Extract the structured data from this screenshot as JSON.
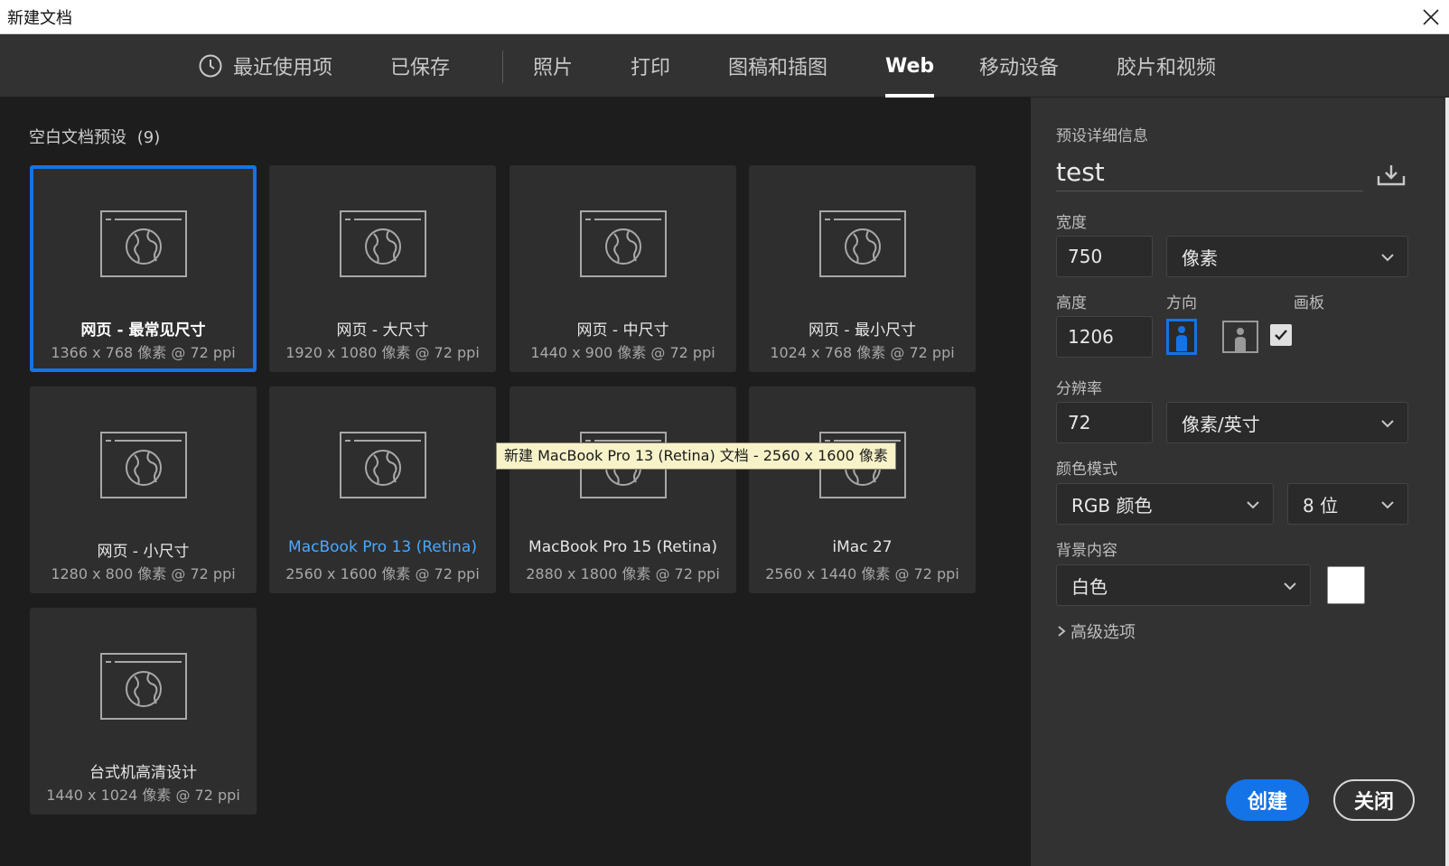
{
  "window": {
    "title": "新建文档",
    "close_icon": "close-icon"
  },
  "tabs": [
    {
      "label": "最近使用项",
      "icon": "clock-icon"
    },
    {
      "label": "已保存"
    },
    {
      "label": "照片"
    },
    {
      "label": "打印"
    },
    {
      "label": "图稿和插图"
    },
    {
      "label": "Web",
      "active": true
    },
    {
      "label": "移动设备"
    },
    {
      "label": "胶片和视频"
    }
  ],
  "presets": {
    "title": "空白文档预设",
    "count": "(9)",
    "items": [
      {
        "name": "网页 - 最常见尺寸",
        "dims": "1366 x 768 像素 @ 72 ppi",
        "selected": true
      },
      {
        "name": "网页 - 大尺寸",
        "dims": "1920 x 1080 像素 @ 72 ppi"
      },
      {
        "name": "网页 - 中尺寸",
        "dims": "1440 x 900 像素 @ 72 ppi"
      },
      {
        "name": "网页 - 最小尺寸",
        "dims": "1024 x 768 像素 @ 72 ppi"
      },
      {
        "name": "网页 - 小尺寸",
        "dims": "1280 x 800 像素 @ 72 ppi"
      },
      {
        "name": "MacBook Pro 13 (Retina)",
        "dims": "2560 x 1600 像素 @ 72 ppi",
        "hover": true
      },
      {
        "name": "MacBook Pro 15 (Retina)",
        "dims": "2880 x 1800 像素 @ 72 ppi"
      },
      {
        "name": "iMac 27",
        "dims": "2560 x 1440 像素 @ 72 ppi"
      },
      {
        "name": "台式机高清设计",
        "dims": "1440 x 1024 像素 @ 72 ppi"
      }
    ],
    "tooltip": "新建 MacBook Pro 13 (Retina) 文档 - 2560 x 1600 像素"
  },
  "details": {
    "header": "预设详细信息",
    "name": "test",
    "width_label": "宽度",
    "width_value": "750",
    "width_unit": "像素",
    "height_label": "高度",
    "height_value": "1206",
    "orientation_label": "方向",
    "artboard_label": "画板",
    "artboard_checked": true,
    "resolution_label": "分辨率",
    "resolution_value": "72",
    "resolution_unit": "像素/英寸",
    "color_mode_label": "颜色模式",
    "color_mode": "RGB 颜色",
    "bit_depth": "8 位",
    "background_label": "背景内容",
    "background": "白色",
    "background_color": "#ffffff",
    "advanced": "高级选项"
  },
  "buttons": {
    "create": "创建",
    "close": "关闭"
  },
  "colors": {
    "accent": "#1473e6",
    "panel": "#323232",
    "canvas": "#1d1d1d",
    "card": "#2e2e2e"
  }
}
